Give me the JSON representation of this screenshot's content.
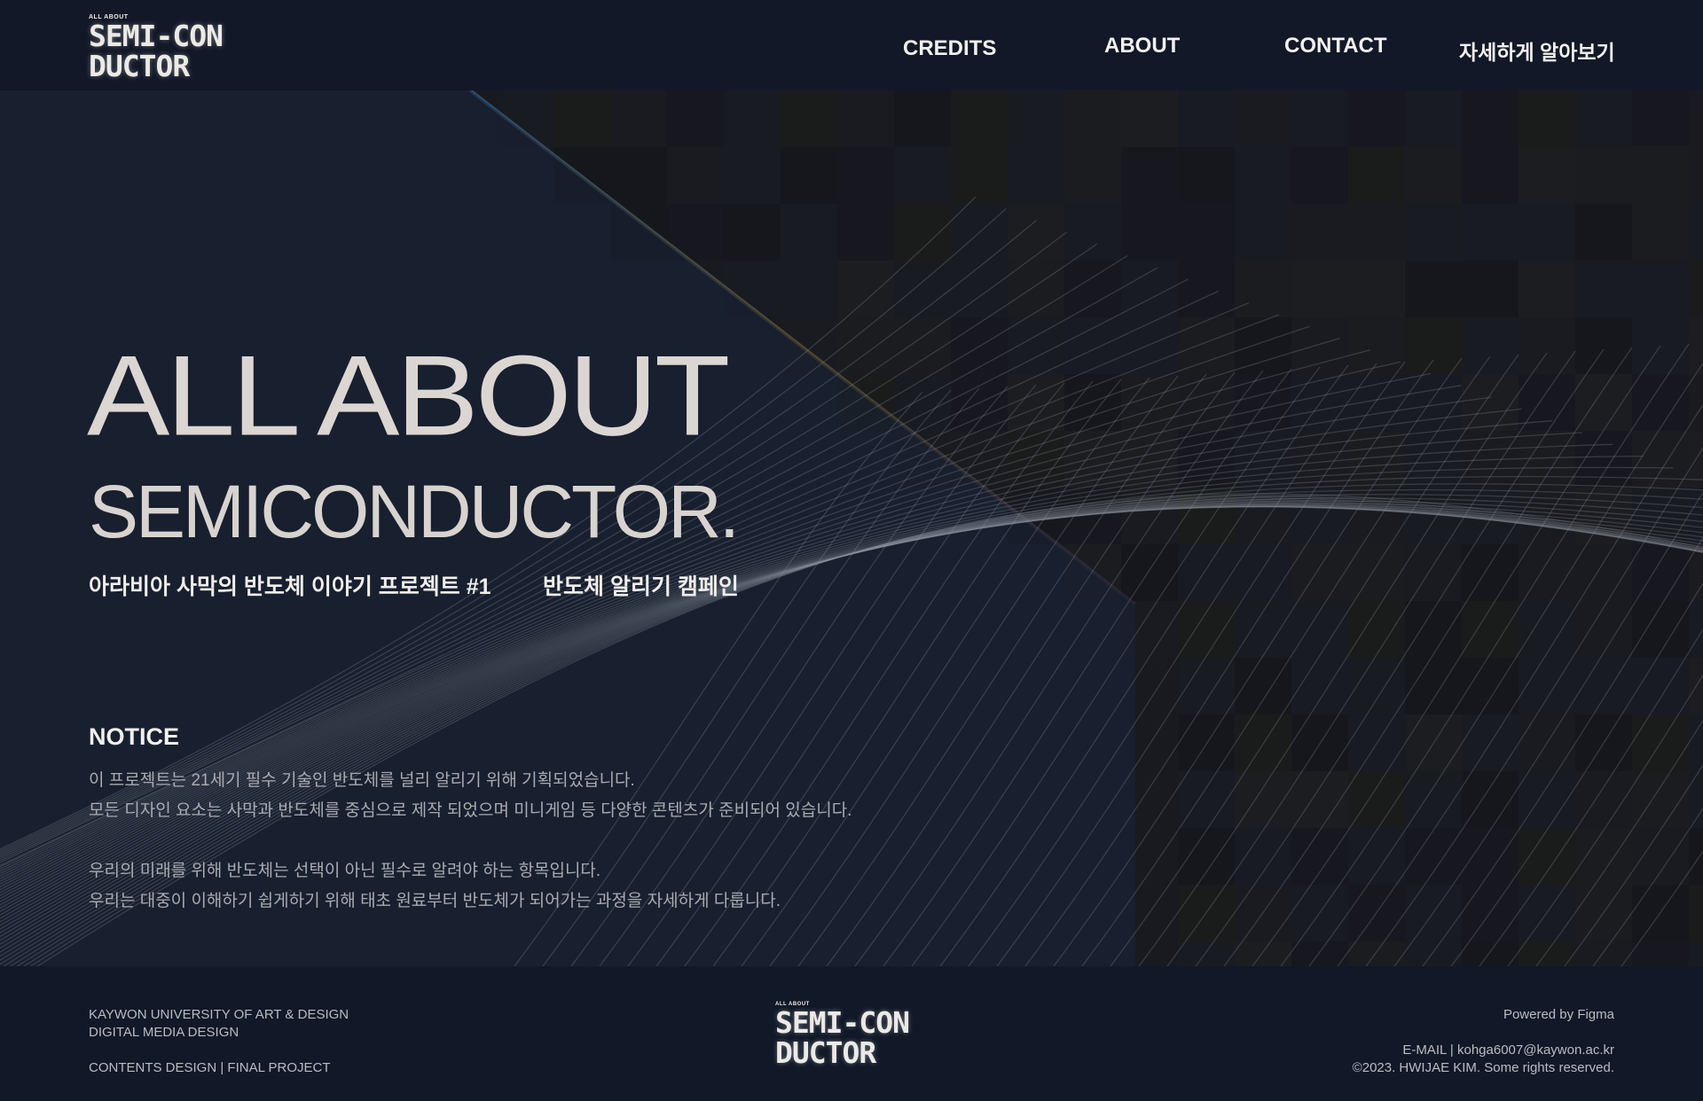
{
  "header": {
    "logo": {
      "top": "ALL ABOUT",
      "line1": "SEMI-CON",
      "line2": "DUCTOR"
    },
    "nav": [
      "CREDITS",
      "ABOUT",
      "CONTACT",
      "자세하게 알아보기"
    ]
  },
  "hero": {
    "title_line1": "ALL ABOUT",
    "title_line2": "SEMICONDUCTOR.",
    "subtitle_left": "아라비아 사막의 반도체 이야기 프로젝트 #1",
    "subtitle_right": "반도체 알리기 캠페인"
  },
  "notice": {
    "title": "NOTICE",
    "lines": [
      "이 프로젝트는 21세기 필수 기술인 반도체를 널리 알리기 위해 기획되었습니다.",
      "모든 디자인 요소는 사막과 반도체를 중심으로 제작 되었으며 미니게임 등 다양한 콘텐츠가 준비되어 있습니다.",
      "우리의 미래를 위해 반도체는 선택이 아닌 필수로 알려야 하는 항목입니다.",
      "우리는 대중이 이해하기 쉽게하기 위해 태초 원료부터 반도체가 되어가는 과정을 자세하게 다룹니다."
    ]
  },
  "footer": {
    "left": [
      "KAYWON UNIVERSITY OF ART & DESIGN",
      "DIGITAL MEDIA DESIGN",
      "CONTENTS DESIGN | FINAL PROJECT"
    ],
    "logo": {
      "top": "ALL ABOUT",
      "line1": "SEMI-CON",
      "line2": "DUCTOR"
    },
    "right": [
      "Powered by Figma",
      "E-MAIL | kohga6007@kaywon.ac.kr",
      "©2023. HWIJAE KIM. Some rights reserved."
    ]
  },
  "colors": {
    "background": "#141a28",
    "header_bg": "#121827",
    "footer_bg": "#111827",
    "title_text": "#dcd6d2",
    "body_text": "#a9abb2"
  }
}
